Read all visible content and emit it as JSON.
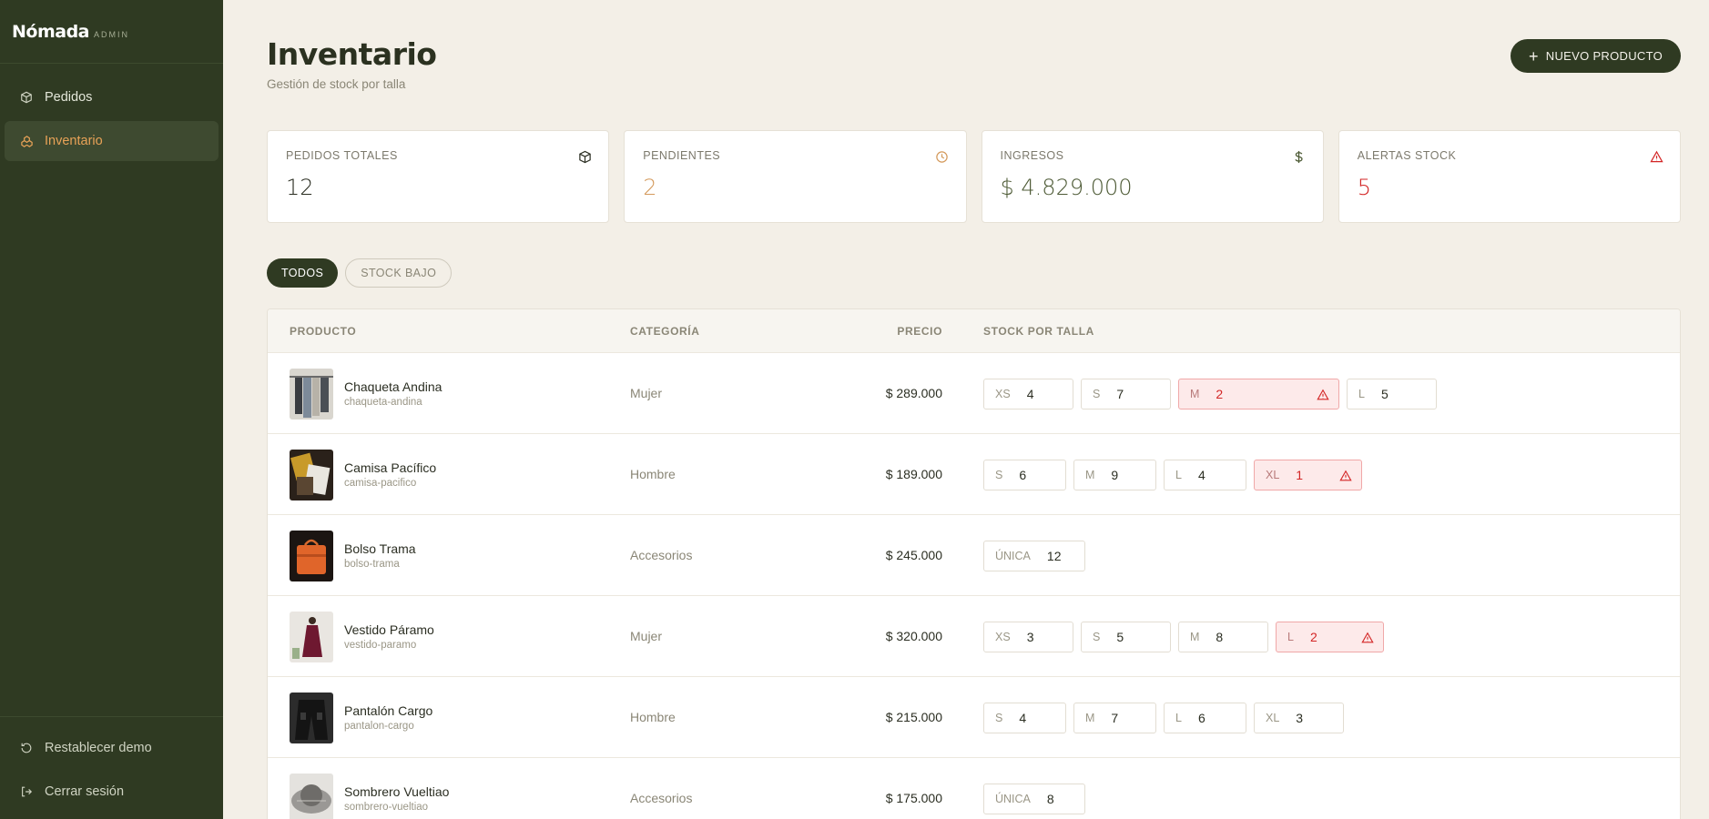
{
  "sidebar": {
    "brand": "Nómada",
    "brand_tag": "ADMIN",
    "items": [
      {
        "label": "Pedidos",
        "icon": "box-icon",
        "active": false
      },
      {
        "label": "Inventario",
        "icon": "layers-icon",
        "active": true
      }
    ],
    "bottom": [
      {
        "label": "Restablecer demo",
        "icon": "reset-icon"
      },
      {
        "label": "Cerrar sesión",
        "icon": "logout-icon"
      }
    ]
  },
  "header": {
    "title": "Inventario",
    "subtitle": "Gestión de stock por talla",
    "new_button": "NUEVO PRODUCTO"
  },
  "stats": [
    {
      "label": "PEDIDOS TOTALES",
      "value": "12",
      "icon": "box-icon",
      "color": "#2b2e22"
    },
    {
      "label": "PENDIENTES",
      "value": "2",
      "icon": "clock-icon",
      "color": "#d49a5c"
    },
    {
      "label": "INGRESOS",
      "value": "$ 4.829.000",
      "icon": "dollar-icon",
      "color": "#4d5a35"
    },
    {
      "label": "ALERTAS STOCK",
      "value": "5",
      "icon": "alert-icon",
      "color": "#d32626"
    }
  ],
  "filters": {
    "all": "TODOS",
    "low": "STOCK BAJO"
  },
  "table": {
    "headers": {
      "product": "PRODUCTO",
      "category": "CATEGORÍA",
      "price": "PRECIO",
      "stock": "STOCK POR TALLA"
    },
    "rows": [
      {
        "name": "Chaqueta Andina",
        "slug": "chaqueta-andina",
        "category": "Mujer",
        "price": "$ 289.000",
        "sizes": [
          {
            "size": "XS",
            "qty": "4",
            "low": false
          },
          {
            "size": "S",
            "qty": "7",
            "low": false
          },
          {
            "size": "M",
            "qty": "2",
            "low": true
          },
          {
            "size": "L",
            "qty": "5",
            "low": false
          }
        ]
      },
      {
        "name": "Camisa Pacífico",
        "slug": "camisa-pacifico",
        "category": "Hombre",
        "price": "$ 189.000",
        "sizes": [
          {
            "size": "S",
            "qty": "6",
            "low": false
          },
          {
            "size": "M",
            "qty": "9",
            "low": false
          },
          {
            "size": "L",
            "qty": "4",
            "low": false
          },
          {
            "size": "XL",
            "qty": "1",
            "low": true
          }
        ]
      },
      {
        "name": "Bolso Trama",
        "slug": "bolso-trama",
        "category": "Accesorios",
        "price": "$ 245.000",
        "sizes": [
          {
            "size": "ÚNICA",
            "qty": "12",
            "low": false
          }
        ]
      },
      {
        "name": "Vestido Páramo",
        "slug": "vestido-paramo",
        "category": "Mujer",
        "price": "$ 320.000",
        "sizes": [
          {
            "size": "XS",
            "qty": "3",
            "low": false
          },
          {
            "size": "S",
            "qty": "5",
            "low": false
          },
          {
            "size": "M",
            "qty": "8",
            "low": false
          },
          {
            "size": "L",
            "qty": "2",
            "low": true
          }
        ]
      },
      {
        "name": "Pantalón Cargo",
        "slug": "pantalon-cargo",
        "category": "Hombre",
        "price": "$ 215.000",
        "sizes": [
          {
            "size": "S",
            "qty": "4",
            "low": false
          },
          {
            "size": "M",
            "qty": "7",
            "low": false
          },
          {
            "size": "L",
            "qty": "6",
            "low": false
          },
          {
            "size": "XL",
            "qty": "3",
            "low": false
          }
        ]
      },
      {
        "name": "Sombrero Vueltiao",
        "slug": "sombrero-vueltiao",
        "category": "Accesorios",
        "price": "$ 175.000",
        "sizes": [
          {
            "size": "ÚNICA",
            "qty": "8",
            "low": false
          }
        ]
      }
    ]
  }
}
